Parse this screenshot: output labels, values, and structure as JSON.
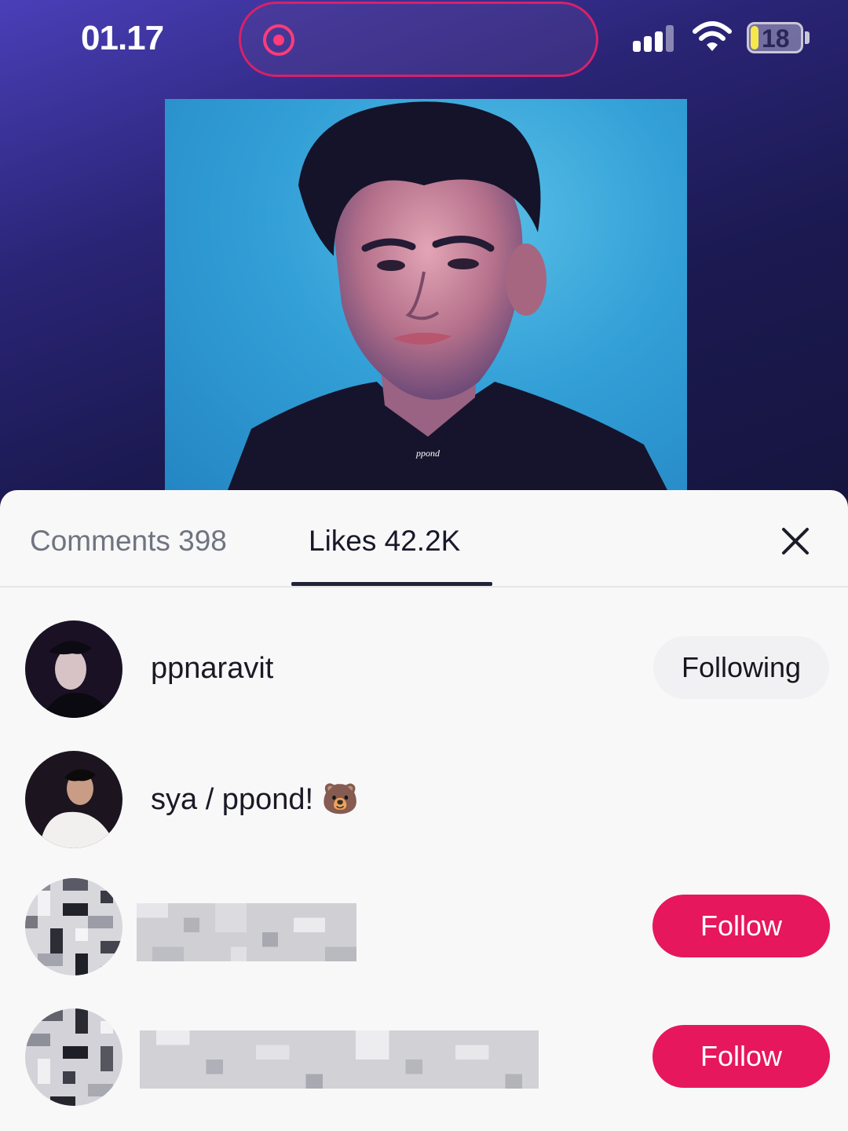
{
  "status_bar": {
    "time": "01.17",
    "battery": "18"
  },
  "media": {
    "watermark": "ppond"
  },
  "tabs": [
    {
      "label": "Comments 398",
      "active": false
    },
    {
      "label": "Likes 42.2K",
      "active": true
    }
  ],
  "likes_list": [
    {
      "username": "ppnaravit",
      "button": "Following"
    },
    {
      "username": "sya / ppond! 🐻",
      "button": ""
    },
    {
      "username": "",
      "button": "Follow"
    },
    {
      "username": "",
      "button": "Follow"
    }
  ],
  "colors": {
    "follow_button": "#e6175c",
    "recording_indicator": "#ff3c78",
    "background_gradient": "#2a2475"
  },
  "icons": {
    "close": "close-icon",
    "record": "record-icon",
    "signal": "signal-icon",
    "wifi": "wifi-icon",
    "battery": "battery-icon"
  }
}
